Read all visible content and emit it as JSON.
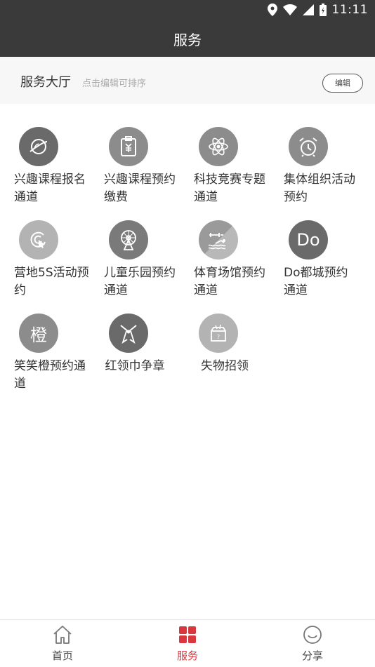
{
  "status_bar": {
    "time": "11:11",
    "icons": [
      "location-icon",
      "wifi-icon",
      "signal-icon",
      "battery-icon"
    ]
  },
  "header": {
    "title": "服务"
  },
  "hall": {
    "title": "服务大厅",
    "hint": "点击编辑可排序",
    "edit_label": "编辑"
  },
  "services": [
    {
      "label": "兴趣课程报名通道",
      "icon": "planet-icon"
    },
    {
      "label": "兴趣课程预约缴费",
      "icon": "payment-clipboard-icon"
    },
    {
      "label": "科技竞赛专题通道",
      "icon": "atom-icon"
    },
    {
      "label": "集体组织活动预约",
      "icon": "alarm-clock-icon"
    },
    {
      "label": "营地5S活动预约",
      "icon": "touch-target-icon"
    },
    {
      "label": "儿童乐园预约通道",
      "icon": "ferris-wheel-icon"
    },
    {
      "label": "体育场馆预约通道",
      "icon": "gym-swim-icon"
    },
    {
      "label": "Do都城预约通道",
      "icon": "do-text-icon",
      "icon_text": "Do"
    },
    {
      "label": "笑笑橙预约通道",
      "icon": "orange-char-icon",
      "icon_text": "橙"
    },
    {
      "label": "红领巾争章",
      "icon": "red-scarf-icon"
    },
    {
      "label": "失物招领",
      "icon": "lost-found-box-icon"
    }
  ],
  "tabs": [
    {
      "label": "首页",
      "icon": "home-icon",
      "active": false
    },
    {
      "label": "服务",
      "icon": "grid-icon",
      "active": true
    },
    {
      "label": "分享",
      "icon": "smile-icon",
      "active": false
    }
  ],
  "colors": {
    "header_bg": "#3a3a3a",
    "accent": "#d9363e",
    "icon_bg": "#7a7a7a"
  }
}
